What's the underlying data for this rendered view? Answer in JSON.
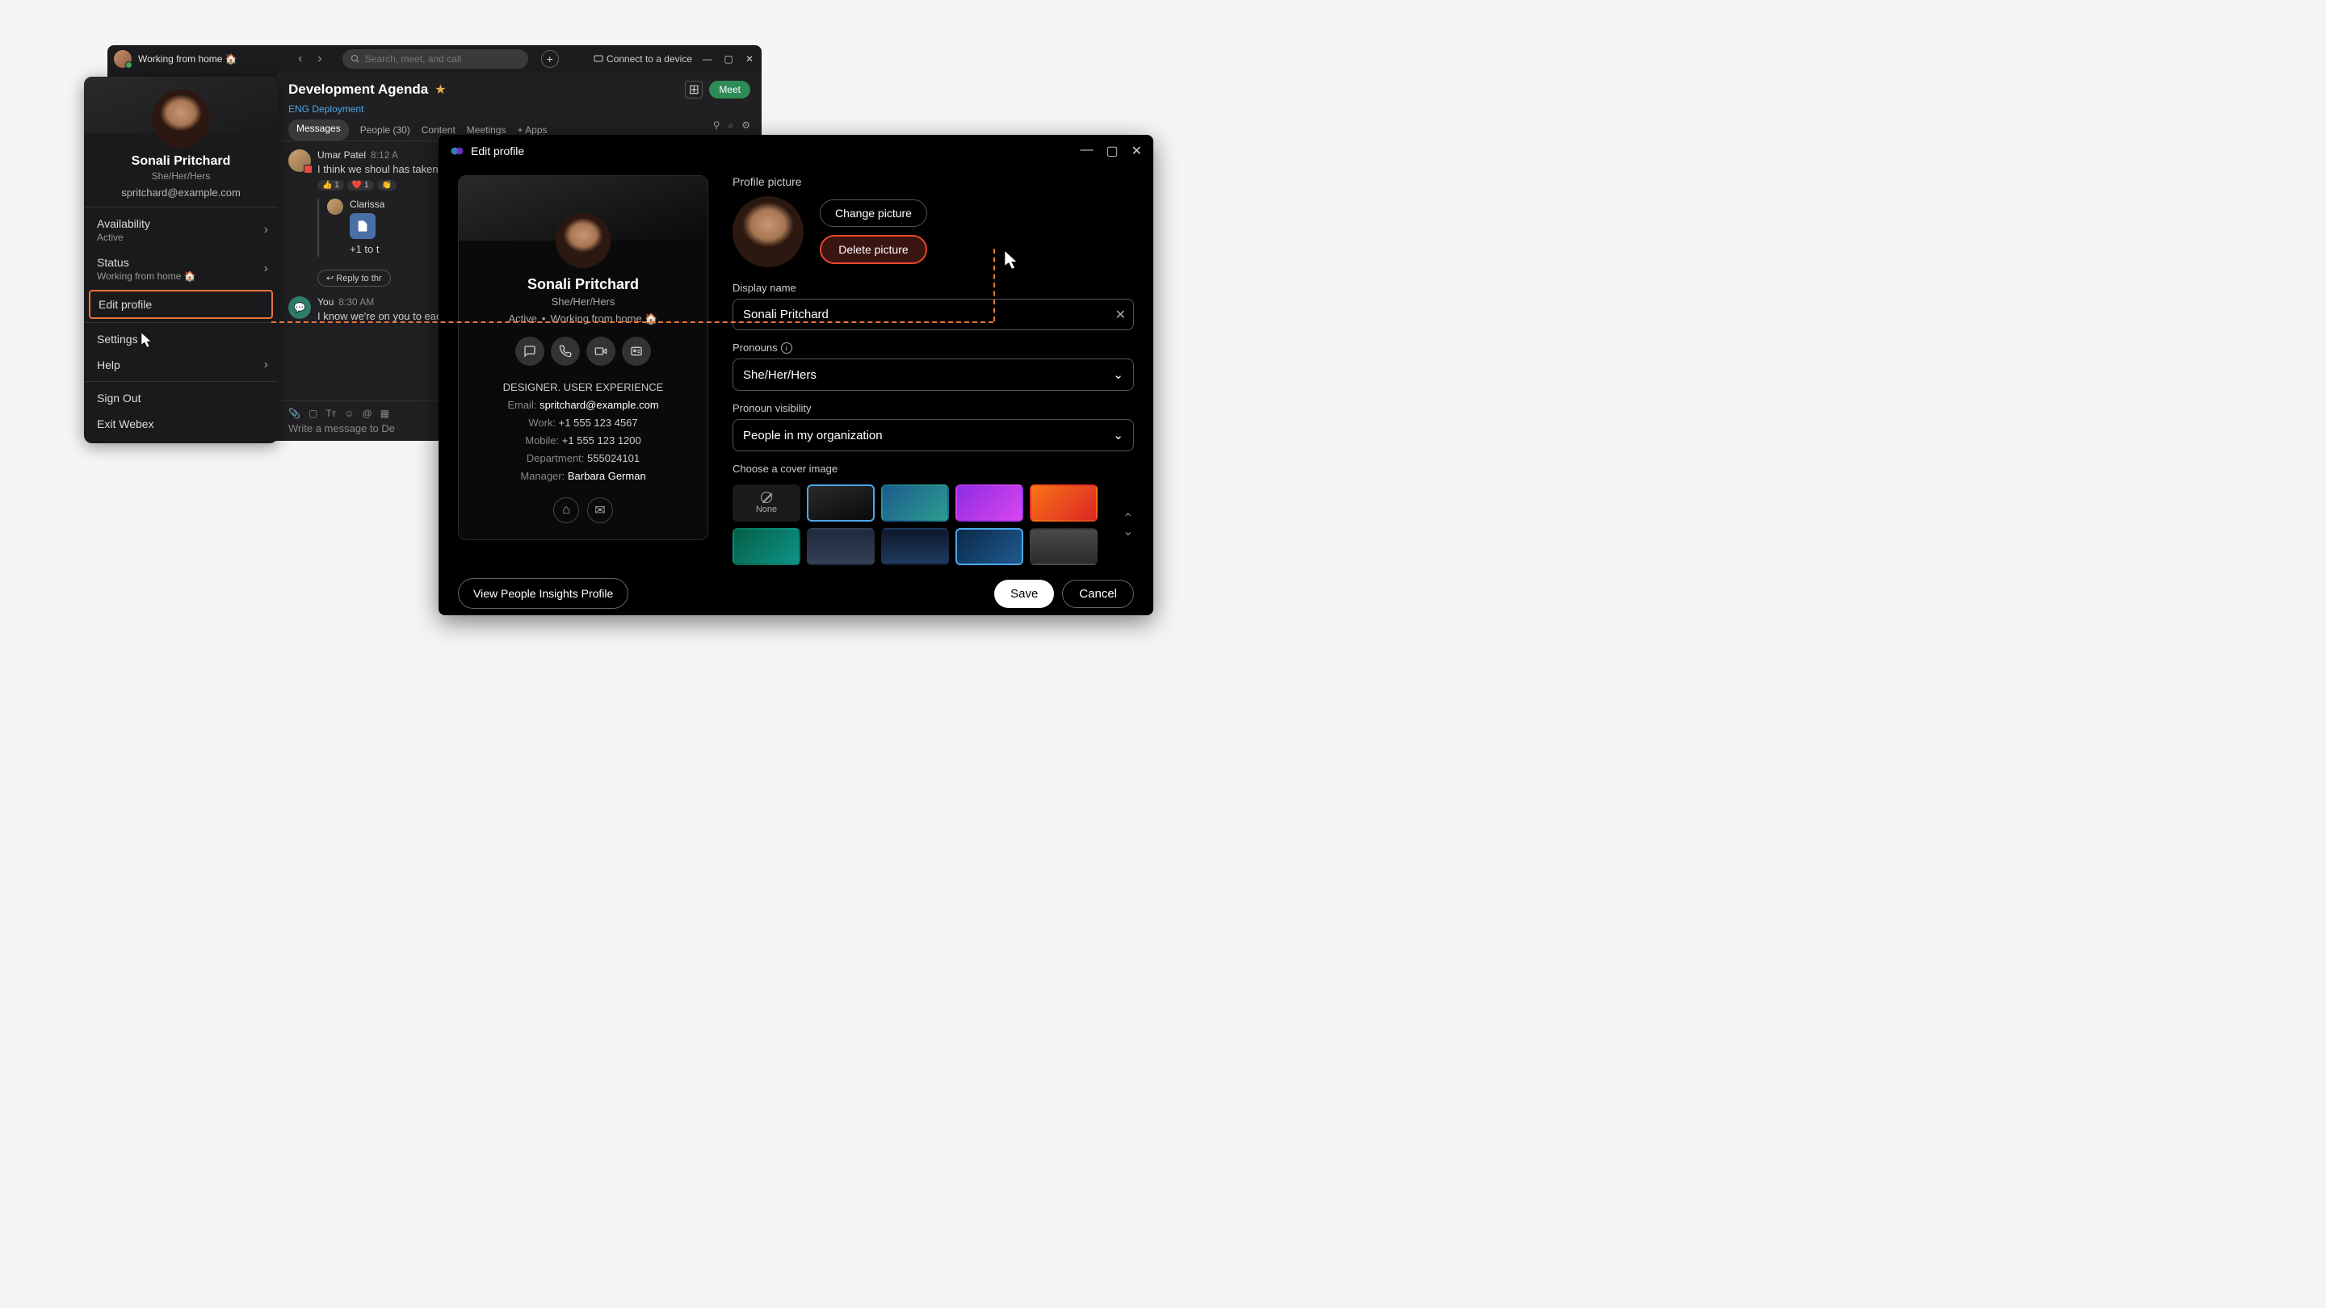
{
  "titlebar": {
    "status": "Working from home 🏠",
    "search_placeholder": "Search, meet, and call",
    "connect": "Connect to a device"
  },
  "chat": {
    "title": "Development Agenda",
    "subtitle": "ENG Deployment",
    "meet": "Meet",
    "tabs": {
      "messages": "Messages",
      "people": "People (30)",
      "content": "Content",
      "meetings": "Meetings",
      "apps": "Apps"
    },
    "msg1_author": "Umar Patel",
    "msg1_time": "8:12 A",
    "msg1_text": "I think we shoul\nhas taken us throug",
    "reply_author": "Clarissa",
    "reply_plus": "+1 to t",
    "reply_btn": "Reply to thr",
    "msg2_author": "You",
    "msg2_time": "8:30 AM",
    "msg2_text": "I know we're on\nyou to each team",
    "compose_placeholder": "Write a message to De"
  },
  "profile_menu": {
    "name": "Sonali Pritchard",
    "pronoun": "She/Her/Hers",
    "email": "spritchard@example.com",
    "availability": "Availability",
    "availability_val": "Active",
    "status": "Status",
    "status_val": "Working from home 🏠",
    "edit_profile": "Edit profile",
    "settings": "Settings",
    "help": "Help",
    "sign_out": "Sign Out",
    "exit": "Exit Webex"
  },
  "edit_modal": {
    "title": "Edit profile",
    "card": {
      "name": "Sonali Pritchard",
      "pronoun": "She/Her/Hers",
      "status_active": "Active",
      "status_wfh": "Working from home 🏠",
      "role": "DESIGNER. USER EXPERIENCE",
      "email_label": "Email: ",
      "email": "spritchard@example.com",
      "work_label": "Work: ",
      "work": "+1 555 123 4567",
      "mobile_label": "Mobile: ",
      "mobile": "+1 555 123 1200",
      "dept_label": "Department: ",
      "dept": "555024101",
      "manager_label": "Manager: ",
      "manager": "Barbara German"
    },
    "form": {
      "profile_picture": "Profile picture",
      "change_picture": "Change picture",
      "delete_picture": "Delete picture",
      "display_name": "Display name",
      "display_name_value": "Sonali Pritchard",
      "pronouns": "Pronouns",
      "pronouns_value": "She/Her/Hers",
      "visibility": "Pronoun visibility",
      "visibility_value": "People in my organization",
      "cover": "Choose a cover image",
      "none": "None"
    },
    "footer": {
      "insights": "View People Insights Profile",
      "save": "Save",
      "cancel": "Cancel"
    }
  }
}
